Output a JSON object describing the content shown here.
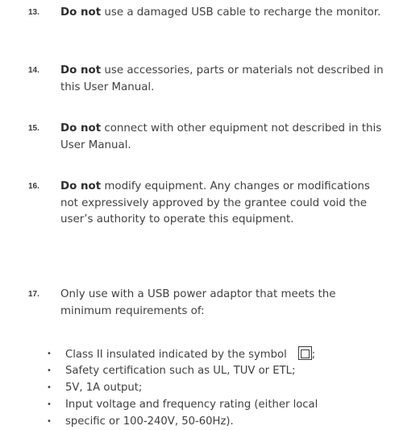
{
  "items": [
    {
      "number": "13.",
      "bold": "Do not",
      "rest": " use a damaged USB cable to recharge the monitor."
    },
    {
      "number": "14.",
      "bold": "Do not",
      "rest": " use accessories, parts or materials not described in this User Manual."
    },
    {
      "number": "15.",
      "bold": "Do not",
      "rest": " connect with other equipment not described in this User Manual."
    },
    {
      "number": "16.",
      "bold": "Do not",
      "rest": " modify equipment. Any changes or modifications not expressively approved by the grantee could void the user’s authority to operate this equipment."
    },
    {
      "number": "17.",
      "bold": "",
      "rest": "Only use with a USB power adaptor that meets the minimum requirements of:"
    }
  ],
  "bullets": [
    {
      "text": "Class II insulated indicated by  the symbol",
      "suffix": ";"
    },
    {
      "text": "Safety certification such as UL, TUV or ETL;"
    },
    {
      "text": "5V,  1A output;"
    },
    {
      "text": "Input voltage and frequency rating (either local"
    },
    {
      "text": " specific or 100-240V,  50-60Hz)."
    }
  ],
  "symbol_icon": "class-ii-double-square-icon"
}
